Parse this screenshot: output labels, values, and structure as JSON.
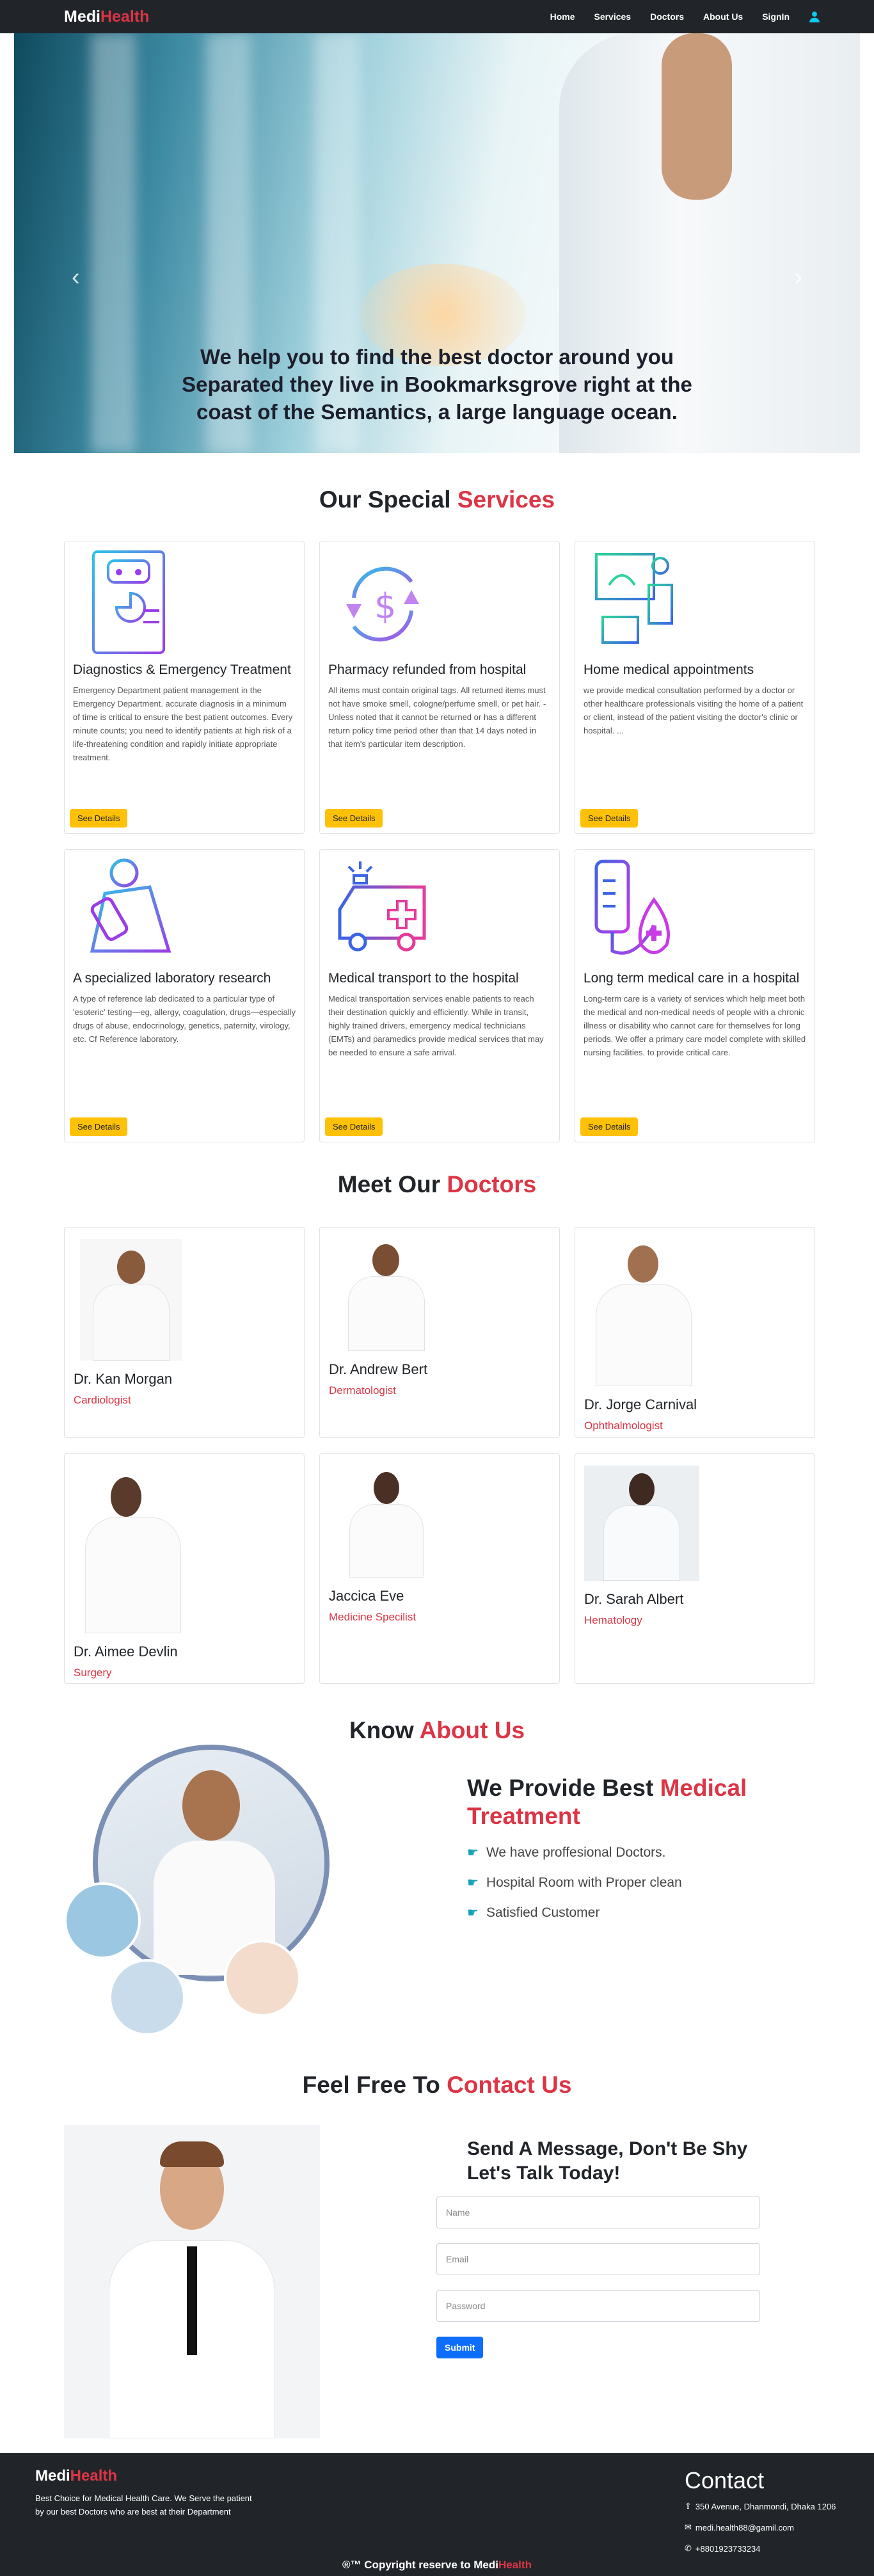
{
  "nav": {
    "brand_a": "Medi",
    "brand_b": "Health",
    "links": [
      "Home",
      "Services",
      "Doctors",
      "About Us",
      "SignIn"
    ]
  },
  "hero": {
    "line1": "We help you to find the best doctor around you",
    "line2": "Separated they live in Bookmarksgrove right at the",
    "line3": "coast of the Semantics, a large language ocean."
  },
  "services": {
    "title_a": "Our Special",
    "title_b": "Services",
    "button": "See Details",
    "items": [
      {
        "icon": "robot-report-icon",
        "title": "Diagnostics & Emergency Treatment",
        "desc": "Emergency Department patient management in the Emergency Department. accurate diagnosis in a minimum of time is critical to ensure the best patient outcomes. Every minute counts; you need to identify patients at high risk of a life-threatening condition and rapidly initiate appropriate treatment."
      },
      {
        "icon": "dollar-refund-icon",
        "title": "Pharmacy refunded from hospital",
        "desc": "All items must contain original tags. All returned items must not have smoke smell, cologne/perfume smell, or pet hair. -Unless noted that it cannot be returned or has a different return policy time period other than that 14 days noted in that item's particular item description."
      },
      {
        "icon": "home-doctor-icon",
        "title": "Home medical appointments",
        "desc": "we provide medical consultation performed by a doctor or other healthcare professionals visiting the home of a patient or client, instead of the patient visiting the doctor's clinic or hospital. ..."
      },
      {
        "icon": "microscope-icon",
        "title": "A specialized laboratory research",
        "desc": "A type of reference lab dedicated to a particular type of 'esoteric' testing—eg, allergy, coagulation, drugs—especially drugs of abuse, endocrinology, genetics, paternity, virology, etc. Cf Reference laboratory."
      },
      {
        "icon": "ambulance-icon",
        "title": "Medical transport to the hospital",
        "desc": "Medical transportation services enable patients to reach their destination quickly and efficiently. While in transit, highly trained drivers, emergency medical technicians (EMTs) and paramedics provide medical services that may be needed to ensure a safe arrival."
      },
      {
        "icon": "iv-drip-icon",
        "title": "Long term medical care in a hospital",
        "desc": "Long-term care is a variety of services which help meet both the medical and non-medical needs of people with a chronic illness or disability who cannot care for themselves for long periods. We offer a primary care model complete with skilled nursing facilities. to provide critical care."
      }
    ]
  },
  "doctors": {
    "title_a": "Meet Our",
    "title_b": "Doctors",
    "items": [
      {
        "name": "Dr. Kan Morgan",
        "spec": "Cardiologist"
      },
      {
        "name": "Dr. Andrew Bert",
        "spec": "Dermatologist"
      },
      {
        "name": "Dr. Jorge Carnival",
        "spec": "Ophthalmologist"
      },
      {
        "name": "Dr. Aimee Devlin",
        "spec": "Surgery"
      },
      {
        "name": "Jaccica Eve",
        "spec": "Medicine Specilist"
      },
      {
        "name": "Dr. Sarah Albert",
        "spec": "Hematology"
      }
    ]
  },
  "about": {
    "title_a": "Know",
    "title_b": "About Us",
    "head_a": "We Provide Best",
    "head_b": "Medical Treatment",
    "items": [
      "We have proffesional Doctors.",
      "Hospital Room with Proper clean",
      "Satisfied Customer"
    ]
  },
  "contact": {
    "title_a": "Feel Free To",
    "title_b": "Contact Us",
    "head1": "Send A Message, Don't Be Shy",
    "head2": "Let's Talk Today!",
    "name_placeholder": "Name",
    "email_placeholder": "Email",
    "password_placeholder": "Password",
    "submit": "Submit"
  },
  "footer": {
    "brand_a": "Medi",
    "brand_b": "Health",
    "tagline": "Best Choice for Medical Health Care. We Serve the patient by our best Doctors who are best at their Department",
    "contact_title": "Contact",
    "address": "350 Avenue, Dhanmondi, Dhaka 1206",
    "email": "medi.health88@gamil.com",
    "phone": "+8801923733234",
    "copy_a": "®™ Copyright reserve to Medi",
    "copy_b": "Health"
  },
  "colors": {
    "accent_red": "#dc3545",
    "button_yellow": "#ffc107",
    "submit_blue": "#0d6efd",
    "dark": "#212529"
  }
}
